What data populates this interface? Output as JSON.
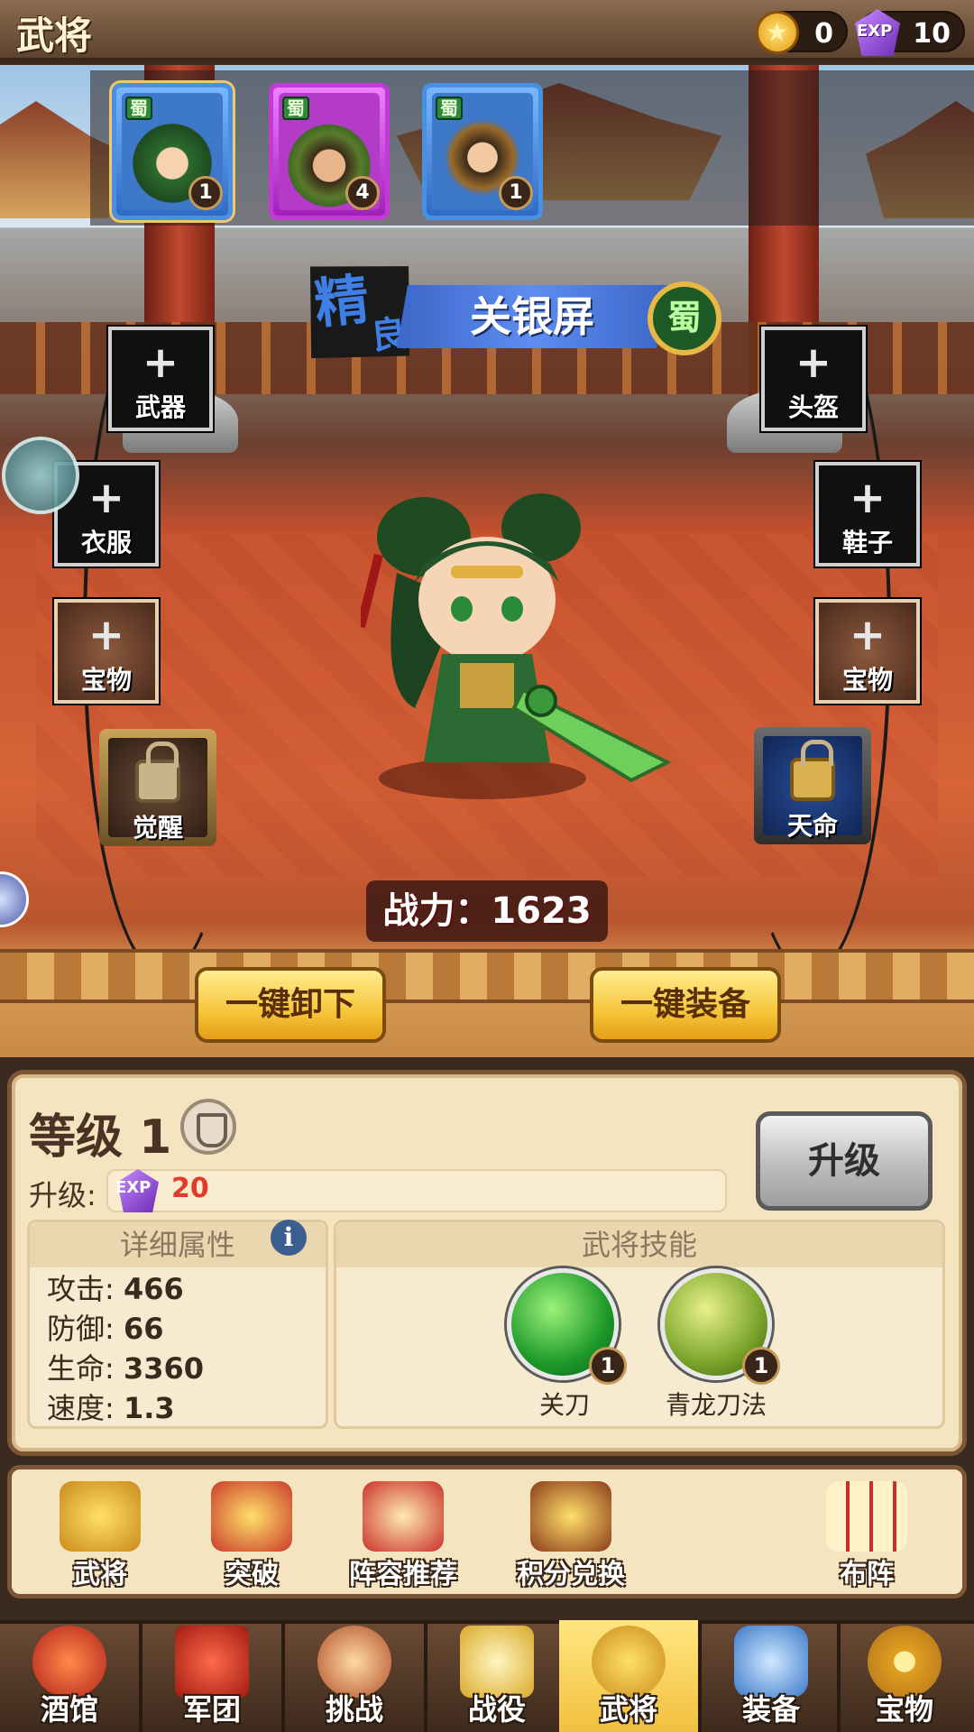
{
  "header": {
    "title": "武将"
  },
  "currency": {
    "gold": "0",
    "exp_icon": "EXP",
    "exp": "10"
  },
  "hero_list": [
    {
      "faction": "蜀",
      "level": "1",
      "quality": "blue",
      "selected": true
    },
    {
      "faction": "蜀",
      "level": "4",
      "quality": "purple",
      "selected": false
    },
    {
      "faction": "蜀",
      "level": "1",
      "quality": "blue",
      "selected": false
    }
  ],
  "hero": {
    "grade_1": "精",
    "grade_2": "良",
    "name": "关银屏",
    "faction": "蜀",
    "power_label": "战力：",
    "power": "1623"
  },
  "slots": {
    "weapon": "武器",
    "clothes": "衣服",
    "treasure_left": "宝物",
    "awaken": "觉醒",
    "helmet": "头盔",
    "shoes": "鞋子",
    "treasure_right": "宝物",
    "destiny": "天命",
    "plus": "+"
  },
  "actions": {
    "unequip_all": "一键卸下",
    "equip_all": "一键装备"
  },
  "level": {
    "title": "等级 1",
    "upgrade_label": "升级:",
    "upgrade_cost_icon": "EXP",
    "upgrade_cost": "20",
    "upgrade_button": "升级"
  },
  "attributes": {
    "header": "详细属性",
    "info_icon": "i",
    "items": [
      {
        "label": "攻击:",
        "value": "466"
      },
      {
        "label": "防御:",
        "value": "66"
      },
      {
        "label": "生命:",
        "value": "3360"
      },
      {
        "label": "速度:",
        "value": "1.3"
      }
    ]
  },
  "skills": {
    "header": "武将技能",
    "items": [
      {
        "name": "关刀",
        "level": "1"
      },
      {
        "name": "青龙刀法",
        "level": "1"
      }
    ]
  },
  "functions": [
    "武将",
    "突破",
    "阵容推荐",
    "积分兑换",
    "布阵"
  ],
  "nav": [
    {
      "label": "酒馆",
      "active": false
    },
    {
      "label": "军团",
      "active": false
    },
    {
      "label": "挑战",
      "active": false
    },
    {
      "label": "战役",
      "active": false
    },
    {
      "label": "武将",
      "active": true
    },
    {
      "label": "装备",
      "active": false
    },
    {
      "label": "宝物",
      "active": false
    }
  ],
  "colors": {
    "accent_gold": "#f6c53a",
    "name_blue": "#3f7ee5",
    "cost_red": "#e23a2a",
    "shu_green": "#2f8a3a"
  }
}
